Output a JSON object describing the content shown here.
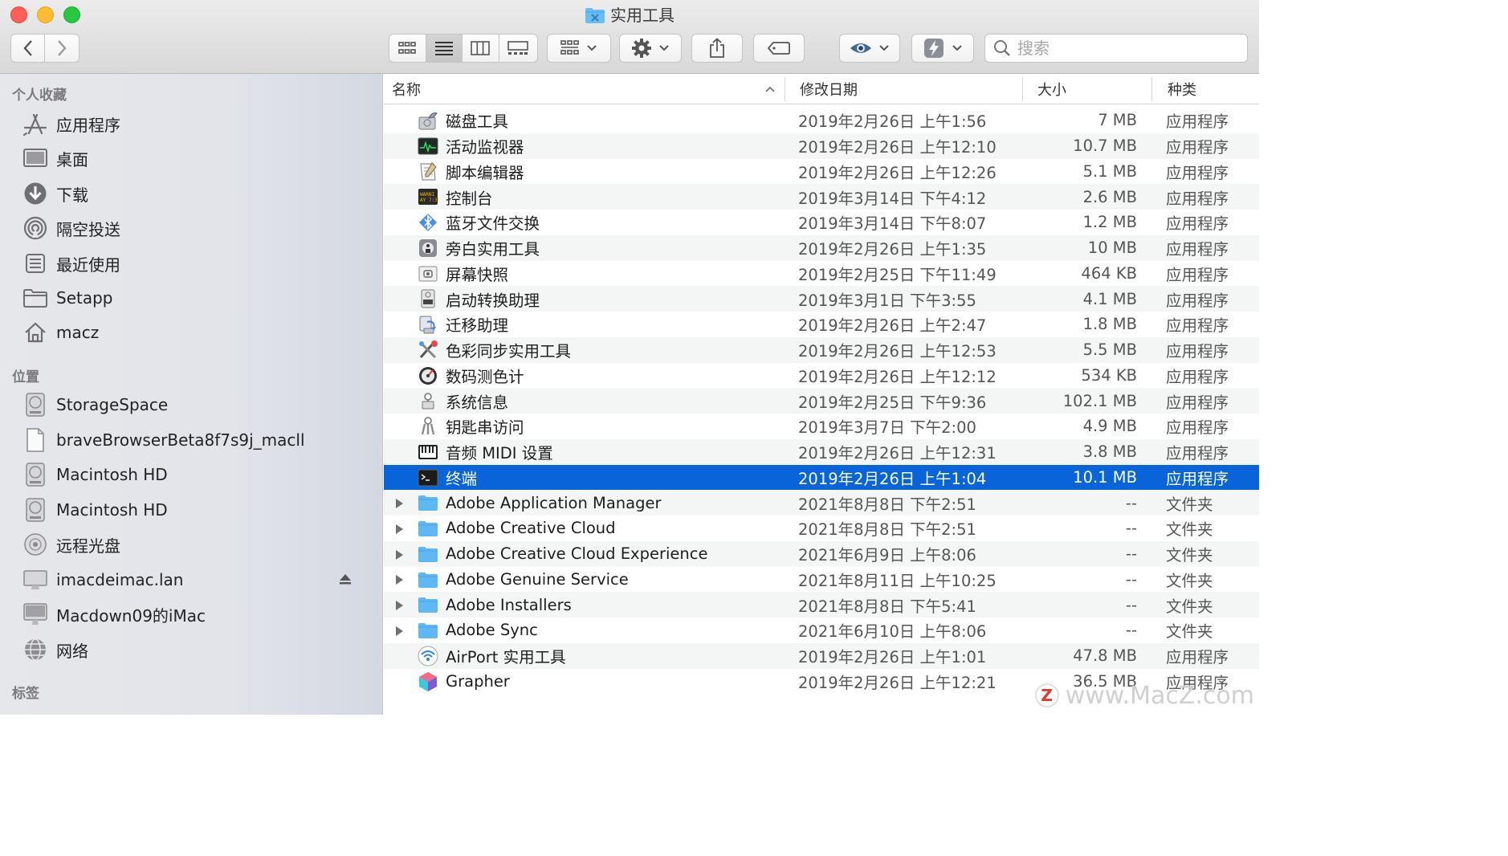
{
  "window": {
    "title": "实用工具"
  },
  "toolbar": {
    "search_placeholder": "搜索",
    "view_modes": [
      "icon-view",
      "list-view",
      "column-view",
      "gallery-view"
    ],
    "active_view": "list-view"
  },
  "sidebar": {
    "favorites_title": "个人收藏",
    "favorites": [
      {
        "label": "应用程序",
        "icon": "applications-icon"
      },
      {
        "label": "桌面",
        "icon": "desktop-icon"
      },
      {
        "label": "下载",
        "icon": "download-icon"
      },
      {
        "label": "隔空投送",
        "icon": "airdrop-icon"
      },
      {
        "label": "最近使用",
        "icon": "recents-icon"
      },
      {
        "label": "Setapp",
        "icon": "folder-icon"
      },
      {
        "label": "macz",
        "icon": "home-icon"
      }
    ],
    "locations_title": "位置",
    "locations": [
      {
        "label": "StorageSpace",
        "icon": "drive-icon"
      },
      {
        "label": "braveBrowserBeta8f7s9j_macll",
        "icon": "document-icon"
      },
      {
        "label": "Macintosh HD",
        "icon": "drive-icon"
      },
      {
        "label": "Macintosh HD",
        "icon": "drive-icon"
      },
      {
        "label": "远程光盘",
        "icon": "disc-icon"
      },
      {
        "label": "imacdeimac.lan",
        "icon": "computer-icon",
        "eject": true
      },
      {
        "label": "Macdown09的iMac",
        "icon": "imac-icon"
      },
      {
        "label": "网络",
        "icon": "network-icon"
      }
    ],
    "tags_title": "标签"
  },
  "columns": {
    "name": "名称",
    "date": "修改日期",
    "size": "大小",
    "kind": "种类"
  },
  "files": [
    {
      "name": "磁盘工具",
      "date": "2019年2月26日 上午1:56",
      "size": "7 MB",
      "kind": "应用程序",
      "icon": "disk-utility-icon"
    },
    {
      "name": "活动监视器",
      "date": "2019年2月26日 上午12:10",
      "size": "10.7 MB",
      "kind": "应用程序",
      "icon": "activity-monitor-icon"
    },
    {
      "name": "脚本编辑器",
      "date": "2019年2月26日 上午12:26",
      "size": "5.1 MB",
      "kind": "应用程序",
      "icon": "script-editor-icon"
    },
    {
      "name": "控制台",
      "date": "2019年3月14日 下午4:12",
      "size": "2.6 MB",
      "kind": "应用程序",
      "icon": "console-icon"
    },
    {
      "name": "蓝牙文件交换",
      "date": "2019年3月14日 下午8:07",
      "size": "1.2 MB",
      "kind": "应用程序",
      "icon": "bluetooth-icon"
    },
    {
      "name": "旁白实用工具",
      "date": "2019年2月26日 上午1:35",
      "size": "10 MB",
      "kind": "应用程序",
      "icon": "voiceover-icon"
    },
    {
      "name": "屏幕快照",
      "date": "2019年2月25日 下午11:49",
      "size": "464 KB",
      "kind": "应用程序",
      "icon": "screenshot-icon"
    },
    {
      "name": "启动转换助理",
      "date": "2019年3月1日 下午3:55",
      "size": "4.1 MB",
      "kind": "应用程序",
      "icon": "boot-camp-icon"
    },
    {
      "name": "迁移助理",
      "date": "2019年2月26日 上午2:47",
      "size": "1.8 MB",
      "kind": "应用程序",
      "icon": "migration-icon"
    },
    {
      "name": "色彩同步实用工具",
      "date": "2019年2月26日 上午12:53",
      "size": "5.5 MB",
      "kind": "应用程序",
      "icon": "colorsync-icon"
    },
    {
      "name": "数码测色计",
      "date": "2019年2月26日 上午12:12",
      "size": "534 KB",
      "kind": "应用程序",
      "icon": "color-meter-icon"
    },
    {
      "name": "系统信息",
      "date": "2019年2月25日 下午9:36",
      "size": "102.1 MB",
      "kind": "应用程序",
      "icon": "system-info-icon"
    },
    {
      "name": "钥匙串访问",
      "date": "2019年3月7日 下午2:00",
      "size": "4.9 MB",
      "kind": "应用程序",
      "icon": "keychain-icon"
    },
    {
      "name": "音频 MIDI 设置",
      "date": "2019年2月26日 上午12:31",
      "size": "3.8 MB",
      "kind": "应用程序",
      "icon": "midi-icon"
    },
    {
      "name": "终端",
      "date": "2019年2月26日 上午1:04",
      "size": "10.1 MB",
      "kind": "应用程序",
      "icon": "terminal-icon",
      "selected": true
    },
    {
      "name": "Adobe Application Manager",
      "date": "2021年8月8日 下午2:51",
      "size": "--",
      "kind": "文件夹",
      "icon": "folder-icon",
      "folder": true
    },
    {
      "name": "Adobe Creative Cloud",
      "date": "2021年8月8日 下午2:51",
      "size": "--",
      "kind": "文件夹",
      "icon": "folder-icon",
      "folder": true
    },
    {
      "name": "Adobe Creative Cloud Experience",
      "date": "2021年6月9日 上午8:06",
      "size": "--",
      "kind": "文件夹",
      "icon": "folder-icon",
      "folder": true
    },
    {
      "name": "Adobe Genuine Service",
      "date": "2021年8月11日 上午10:25",
      "size": "--",
      "kind": "文件夹",
      "icon": "folder-icon",
      "folder": true
    },
    {
      "name": "Adobe Installers",
      "date": "2021年8月8日 下午5:41",
      "size": "--",
      "kind": "文件夹",
      "icon": "folder-icon",
      "folder": true
    },
    {
      "name": "Adobe Sync",
      "date": "2021年6月10日 上午8:06",
      "size": "--",
      "kind": "文件夹",
      "icon": "folder-icon",
      "folder": true
    },
    {
      "name": "AirPort 实用工具",
      "date": "2019年2月26日 上午1:01",
      "size": "47.8 MB",
      "kind": "应用程序",
      "icon": "airport-icon"
    },
    {
      "name": "Grapher",
      "date": "2019年2月26日 上午12:21",
      "size": "36.5 MB",
      "kind": "应用程序",
      "icon": "grapher-icon"
    }
  ],
  "watermark": {
    "text": "www.MacZ.com",
    "logo": "Z"
  },
  "colors": {
    "selection": "#0864d8",
    "folder": "#5fb8f5",
    "accent": "#0a84ff"
  }
}
